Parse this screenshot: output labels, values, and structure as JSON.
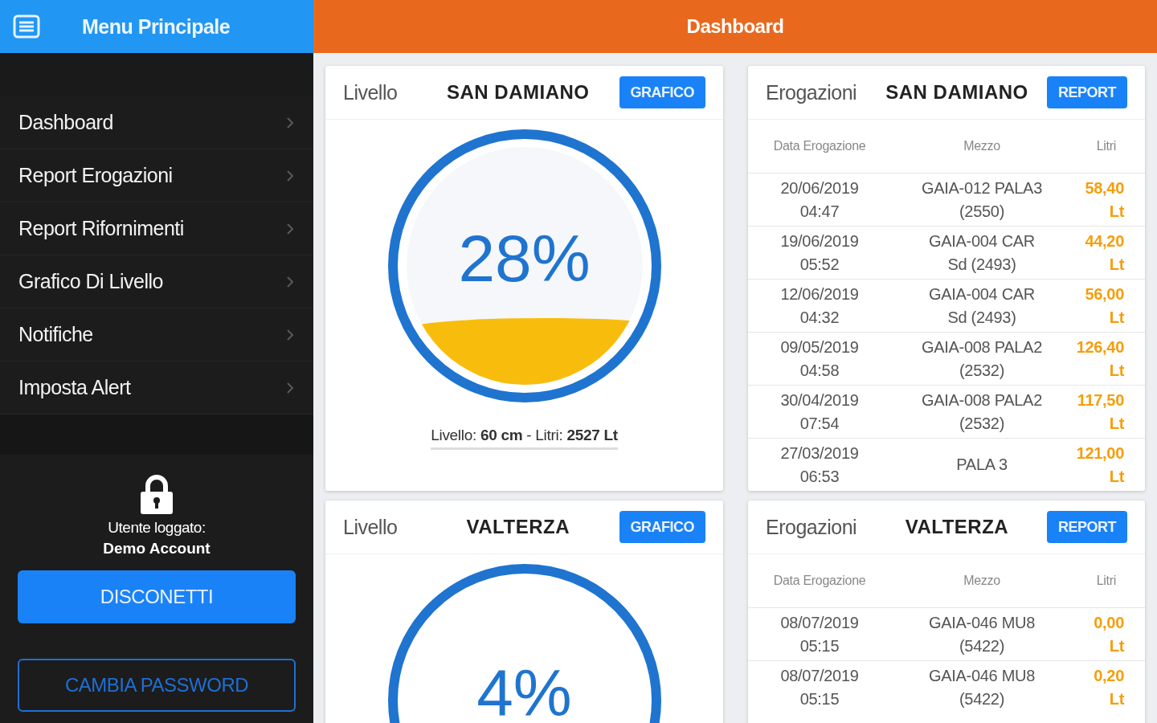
{
  "sidebar": {
    "title": "Menu Principale",
    "items": [
      {
        "label": "Dashboard"
      },
      {
        "label": "Report Erogazioni"
      },
      {
        "label": "Report Rifornimenti"
      },
      {
        "label": "Grafico Di Livello"
      },
      {
        "label": "Notifiche"
      },
      {
        "label": "Imposta Alert"
      }
    ],
    "user_label": "Utente loggato:",
    "user_name": "Demo Account",
    "buttons": [
      {
        "label": "DISCONETTI",
        "kind": "primary"
      },
      {
        "label": "CAMBIA PASSWORD",
        "kind": "outline"
      }
    ]
  },
  "header": {
    "title": "Dashboard"
  },
  "sites": [
    {
      "level_card": {
        "label": "Livello",
        "site": "SAN DAMIANO",
        "button": "GRAFICO",
        "percent": "28%",
        "level": 0.28,
        "caption": "Livello: **60 cm** - Litri: **2527 Lt**"
      },
      "dispense_card": {
        "label": "Erogazioni",
        "site": "SAN DAMIANO",
        "button": "REPORT",
        "columns": [
          "Data Erogazione",
          "Mezzo",
          "Litri"
        ],
        "rows": [
          {
            "date": "20/06/2019",
            "time": "04:47",
            "vehicle": "GAIA-012 PALA3",
            "vehicle_code": "(2550)",
            "liters": "58,40",
            "unit": "Lt"
          },
          {
            "date": "19/06/2019",
            "time": "05:52",
            "vehicle": "GAIA-004 CAR",
            "vehicle_code": "Sd (2493)",
            "liters": "44,20",
            "unit": "Lt"
          },
          {
            "date": "12/06/2019",
            "time": "04:32",
            "vehicle": "GAIA-004 CAR",
            "vehicle_code": "Sd (2493)",
            "liters": "56,00",
            "unit": "Lt"
          },
          {
            "date": "09/05/2019",
            "time": "04:58",
            "vehicle": "GAIA-008 PALA2",
            "vehicle_code": "(2532)",
            "liters": "126,40",
            "unit": "Lt"
          },
          {
            "date": "30/04/2019",
            "time": "07:54",
            "vehicle": "GAIA-008 PALA2",
            "vehicle_code": "(2532)",
            "liters": "117,50",
            "unit": "Lt"
          },
          {
            "date": "27/03/2019",
            "time": "06:53",
            "vehicle": "PALA 3",
            "liters": "121,00",
            "unit": "Lt"
          }
        ]
      }
    },
    {
      "level_card": {
        "label": "Livello",
        "site": "VALTERZA",
        "button": "GRAFICO",
        "percent": "4%"
      },
      "dispense_card": {
        "label": "Erogazioni",
        "site": "VALTERZA",
        "button": "REPORT",
        "columns": [
          "Data Erogazione",
          "Mezzo",
          "Litri"
        ],
        "rows": [
          {
            "date": "08/07/2019",
            "time": "05:15",
            "vehicle": "GAIA-046 MU8",
            "vehicle_code": "(5422)",
            "liters": "0,00",
            "unit": "Lt"
          },
          {
            "date": "08/07/2019",
            "time": "05:15",
            "vehicle": "GAIA-046 MU8",
            "vehicle_code": "(5422)",
            "liters": "0,20",
            "unit": "Lt"
          }
        ]
      }
    }
  ]
}
